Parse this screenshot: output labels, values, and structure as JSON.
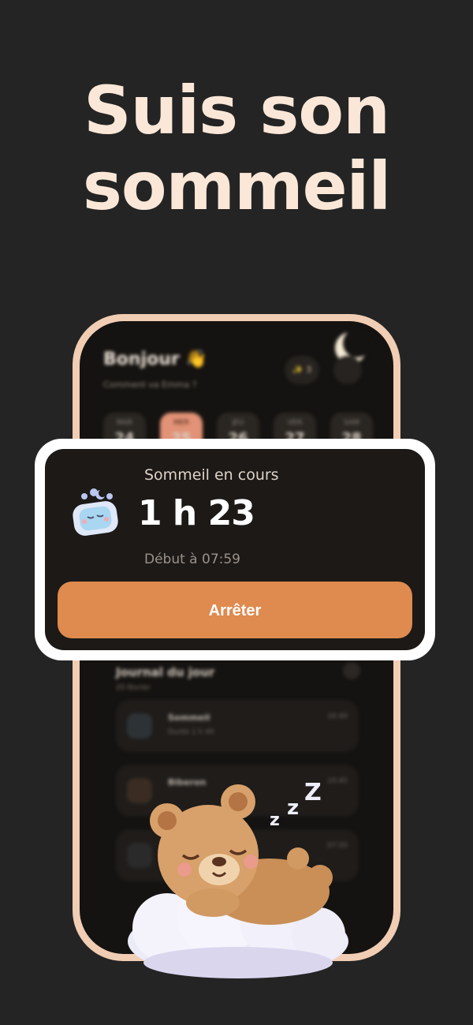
{
  "headline": {
    "line1": "Suis son",
    "line2": "sommeil"
  },
  "phone": {
    "greeting": "Bonjour 👋",
    "subtitle": "Comment va Emma ?",
    "streak": "✨ 3",
    "days": [
      {
        "name": "MAR",
        "num": "24"
      },
      {
        "name": "MER",
        "num": "25",
        "active": true
      },
      {
        "name": "JEU",
        "num": "26"
      },
      {
        "name": "VEN",
        "num": "27"
      },
      {
        "name": "SAM",
        "num": "28"
      }
    ],
    "journal": {
      "title": "Journal du jour",
      "date": "25 février",
      "entries": [
        {
          "title": "Sommeil",
          "sub": "Durée 1 h 40",
          "time": "16:40"
        },
        {
          "title": "Biberon",
          "sub": "",
          "time": "10:45"
        },
        {
          "title": "",
          "sub": "",
          "time": "07:55"
        }
      ]
    },
    "fab": "+"
  },
  "card": {
    "label": "Sommeil en cours",
    "duration": "1 h 23",
    "start": "Début à 07:59",
    "stop_label": "Arrêter"
  },
  "colors": {
    "background": "#242424",
    "accent": "#df8a4f",
    "headline": "#fbe7d8",
    "phone_frame": "#f0cdb3"
  },
  "icons": [
    "moon-icon",
    "bell-icon",
    "pillow-icon",
    "home-icon",
    "plus-icon",
    "sleeping-bear-illustration"
  ]
}
